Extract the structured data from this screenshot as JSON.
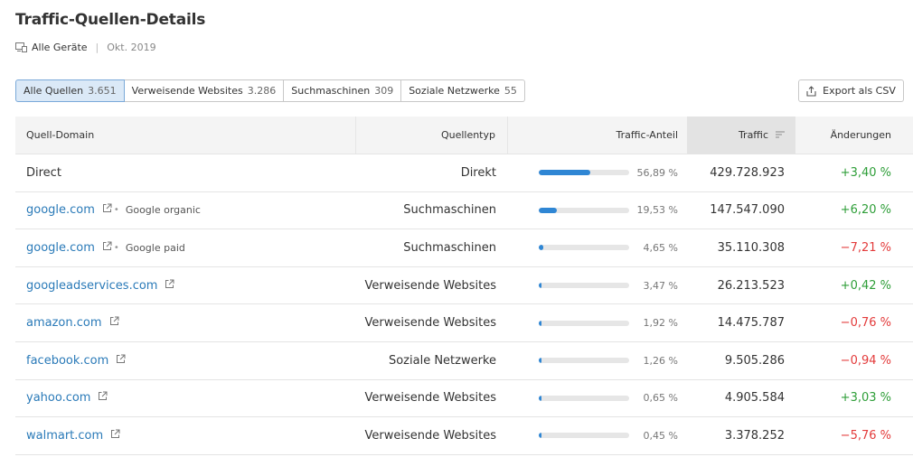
{
  "header": {
    "title": "Traffic-Quellen-Details",
    "device_label": "Alle Geräte",
    "separator": "|",
    "date": "Okt. 2019"
  },
  "filters": [
    {
      "label": "Alle Quellen",
      "count": "3.651",
      "active": true
    },
    {
      "label": "Verweisende Websites",
      "count": "3.286",
      "active": false
    },
    {
      "label": "Suchmaschinen",
      "count": "309",
      "active": false
    },
    {
      "label": "Soziale Netzwerke",
      "count": "55",
      "active": false
    }
  ],
  "export_label": "Export als CSV",
  "table": {
    "columns": {
      "domain": "Quell-Domain",
      "type": "Quellentyp",
      "share": "Traffic-Anteil",
      "traffic": "Traffic",
      "change": "Änderungen"
    },
    "rows": [
      {
        "domain": "Direct",
        "link": false,
        "sub": "",
        "type": "Direkt",
        "share_pct": 56.89,
        "share": "56,89 %",
        "traffic": "429.728.923",
        "change": "+3,40 %",
        "dir": "pos"
      },
      {
        "domain": "google.com",
        "link": true,
        "sub": "Google organic",
        "type": "Suchmaschinen",
        "share_pct": 19.53,
        "share": "19,53 %",
        "traffic": "147.547.090",
        "change": "+6,20 %",
        "dir": "pos"
      },
      {
        "domain": "google.com",
        "link": true,
        "sub": "Google paid",
        "type": "Suchmaschinen",
        "share_pct": 4.65,
        "share": "4,65 %",
        "traffic": "35.110.308",
        "change": "−7,21 %",
        "dir": "neg"
      },
      {
        "domain": "googleadservices.com",
        "link": true,
        "sub": "",
        "type": "Verweisende Websites",
        "share_pct": 3.47,
        "share": "3,47 %",
        "traffic": "26.213.523",
        "change": "+0,42 %",
        "dir": "pos"
      },
      {
        "domain": "amazon.com",
        "link": true,
        "sub": "",
        "type": "Verweisende Websites",
        "share_pct": 1.92,
        "share": "1,92 %",
        "traffic": "14.475.787",
        "change": "−0,76 %",
        "dir": "neg"
      },
      {
        "domain": "facebook.com",
        "link": true,
        "sub": "",
        "type": "Soziale Netzwerke",
        "share_pct": 1.26,
        "share": "1,26 %",
        "traffic": "9.505.286",
        "change": "−0,94 %",
        "dir": "neg"
      },
      {
        "domain": "yahoo.com",
        "link": true,
        "sub": "",
        "type": "Verweisende Websites",
        "share_pct": 0.65,
        "share": "0,65 %",
        "traffic": "4.905.584",
        "change": "+3,03 %",
        "dir": "pos"
      },
      {
        "domain": "walmart.com",
        "link": true,
        "sub": "",
        "type": "Verweisende Websites",
        "share_pct": 0.45,
        "share": "0,45 %",
        "traffic": "3.378.252",
        "change": "−5,76 %",
        "dir": "neg"
      }
    ]
  },
  "colors": {
    "link": "#2a7ab8",
    "bar": "#2f86d4",
    "positive": "#2e9e38",
    "negative": "#e33b3b",
    "active_filter": "#dbe9f7"
  }
}
